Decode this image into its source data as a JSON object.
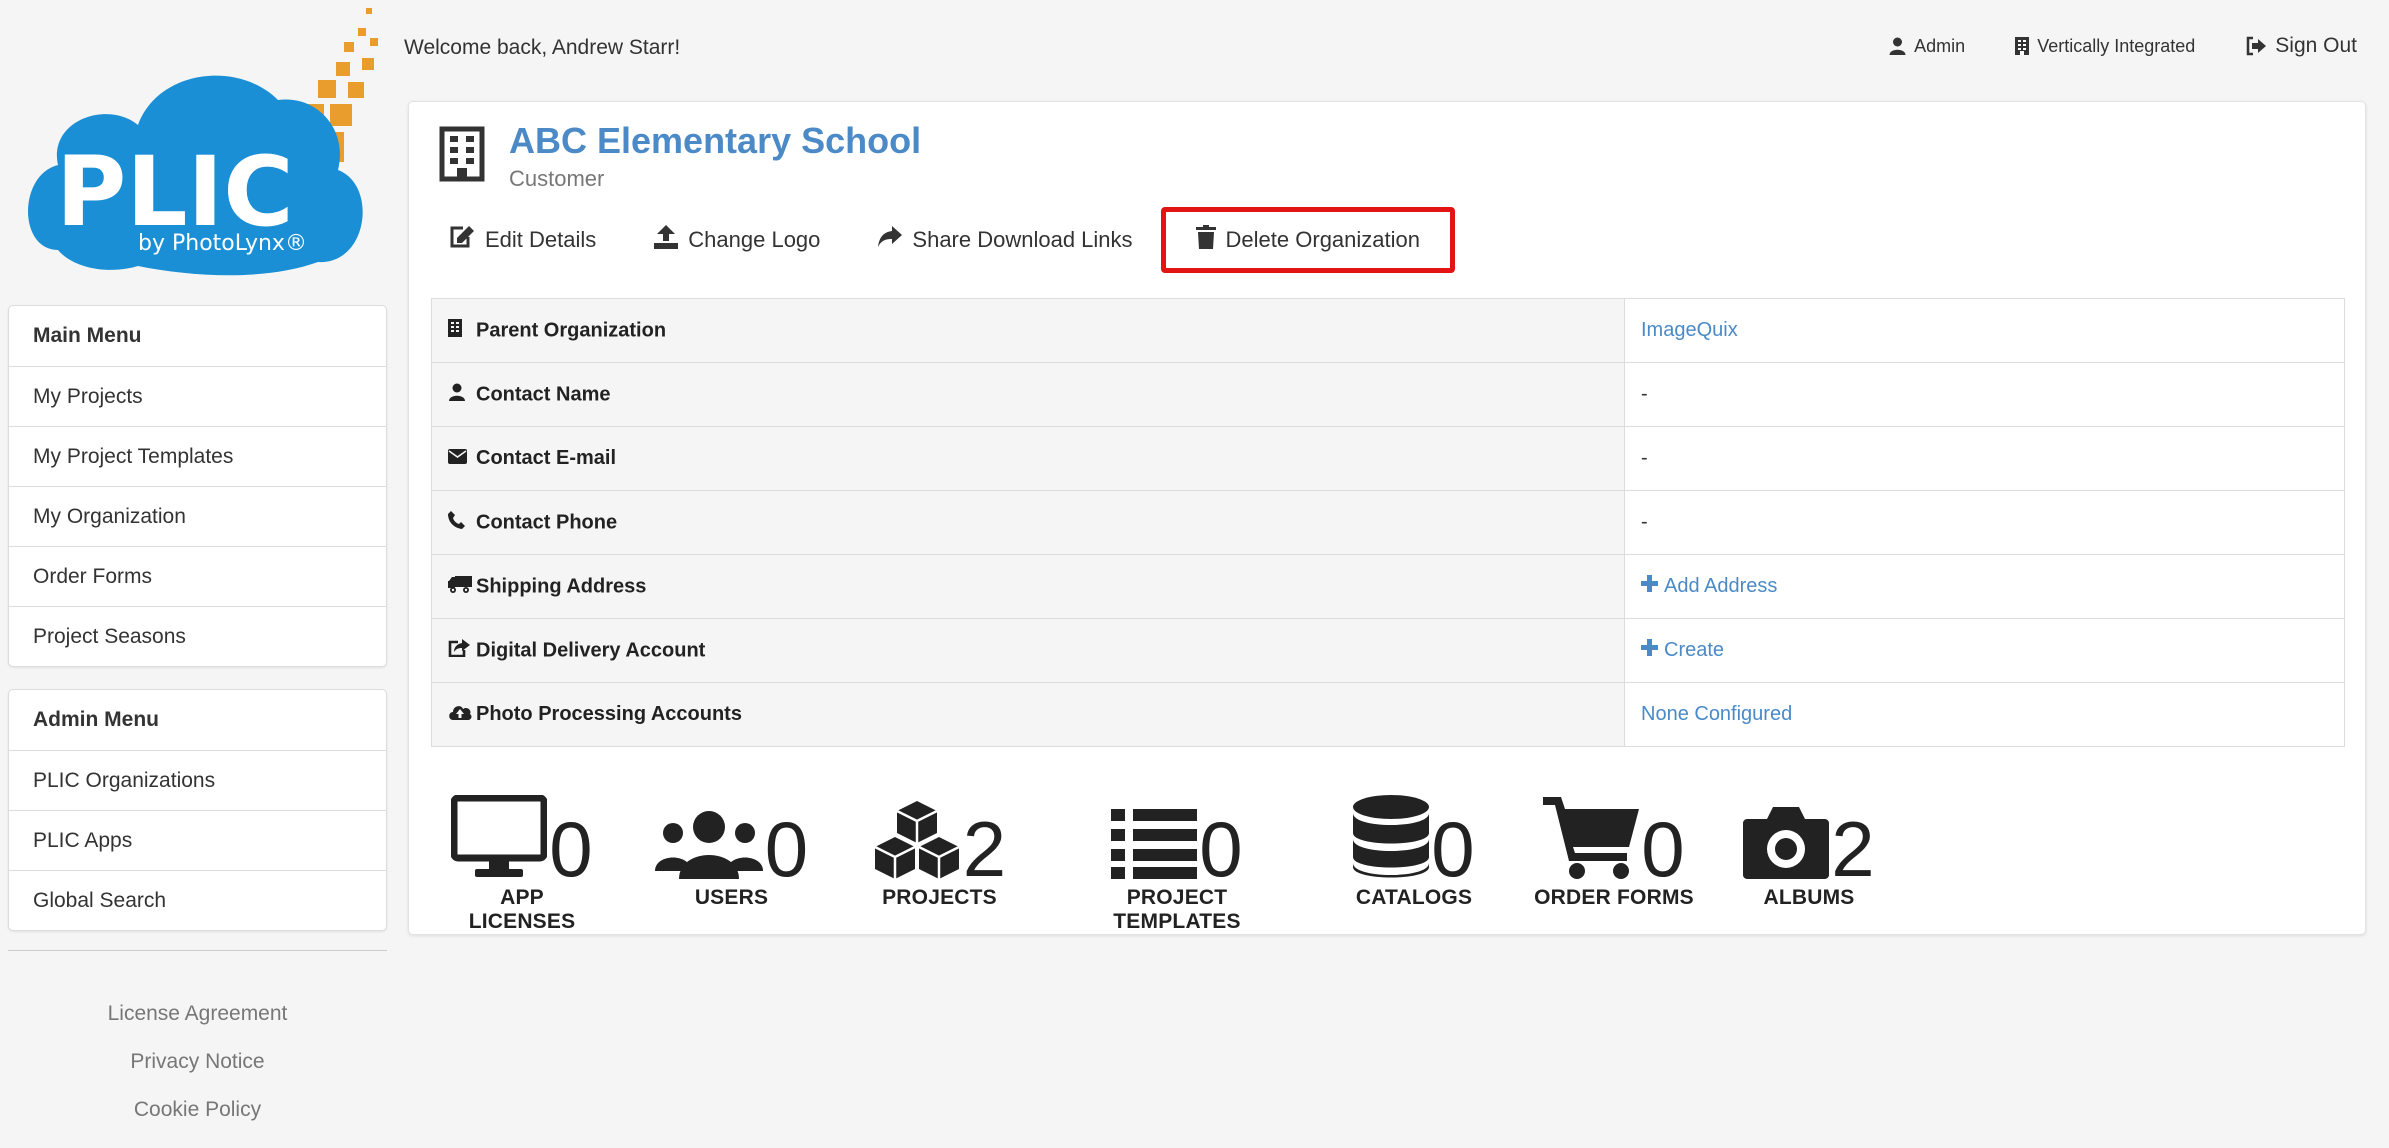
{
  "brand": {
    "logo_text": "PLIC",
    "logo_sub": "by PhotoLynx®",
    "blue": "#1a8fd6",
    "orange": "#e89d2c"
  },
  "header": {
    "welcome": "Welcome back, Andrew Starr!",
    "admin_label": "Admin",
    "org_label": "Vertically Integrated",
    "signout_label": "Sign Out"
  },
  "main_menu": {
    "title": "Main Menu",
    "items": [
      "My Projects",
      "My Project Templates",
      "My Organization",
      "Order Forms",
      "Project Seasons"
    ]
  },
  "admin_menu": {
    "title": "Admin Menu",
    "items": [
      "PLIC Organizations",
      "PLIC Apps",
      "Global Search"
    ]
  },
  "footer": {
    "links": [
      "License Agreement",
      "Privacy Notice",
      "Cookie Policy"
    ]
  },
  "organization": {
    "name": "ABC Elementary School",
    "type": "Customer",
    "actions": {
      "edit": "Edit Details",
      "logo": "Change Logo",
      "share": "Share Download Links",
      "delete": "Delete Organization"
    },
    "details": [
      {
        "label": "Parent Organization",
        "value": "ImageQuix",
        "icon": "building-icon"
      },
      {
        "label": "Contact Name",
        "value": "-",
        "icon": "user-icon"
      },
      {
        "label": "Contact E-mail",
        "value": "-",
        "icon": "envelope-icon"
      },
      {
        "label": "Contact Phone",
        "value": "-",
        "icon": "phone-icon"
      },
      {
        "label": "Shipping Address",
        "value": "Add Address",
        "icon": "truck-icon"
      },
      {
        "label": "Digital Delivery Account",
        "value": "Create",
        "icon": "share-square-icon"
      },
      {
        "label": "Photo Processing Accounts",
        "value": "None Configured",
        "icon": "cloud-upload-icon"
      }
    ]
  },
  "stats": [
    {
      "label": "APP LICENSES",
      "count": "0",
      "icon": "monitor-icon"
    },
    {
      "label": "USERS",
      "count": "0",
      "icon": "users-icon"
    },
    {
      "label": "PROJECTS",
      "count": "2",
      "icon": "cubes-icon"
    },
    {
      "label": "PROJECT TEMPLATES",
      "count": "0",
      "icon": "list-icon"
    },
    {
      "label": "CATALOGS",
      "count": "0",
      "icon": "database-icon"
    },
    {
      "label": "ORDER FORMS",
      "count": "0",
      "icon": "cart-icon"
    },
    {
      "label": "ALBUMS",
      "count": "2",
      "icon": "camera-icon"
    }
  ]
}
